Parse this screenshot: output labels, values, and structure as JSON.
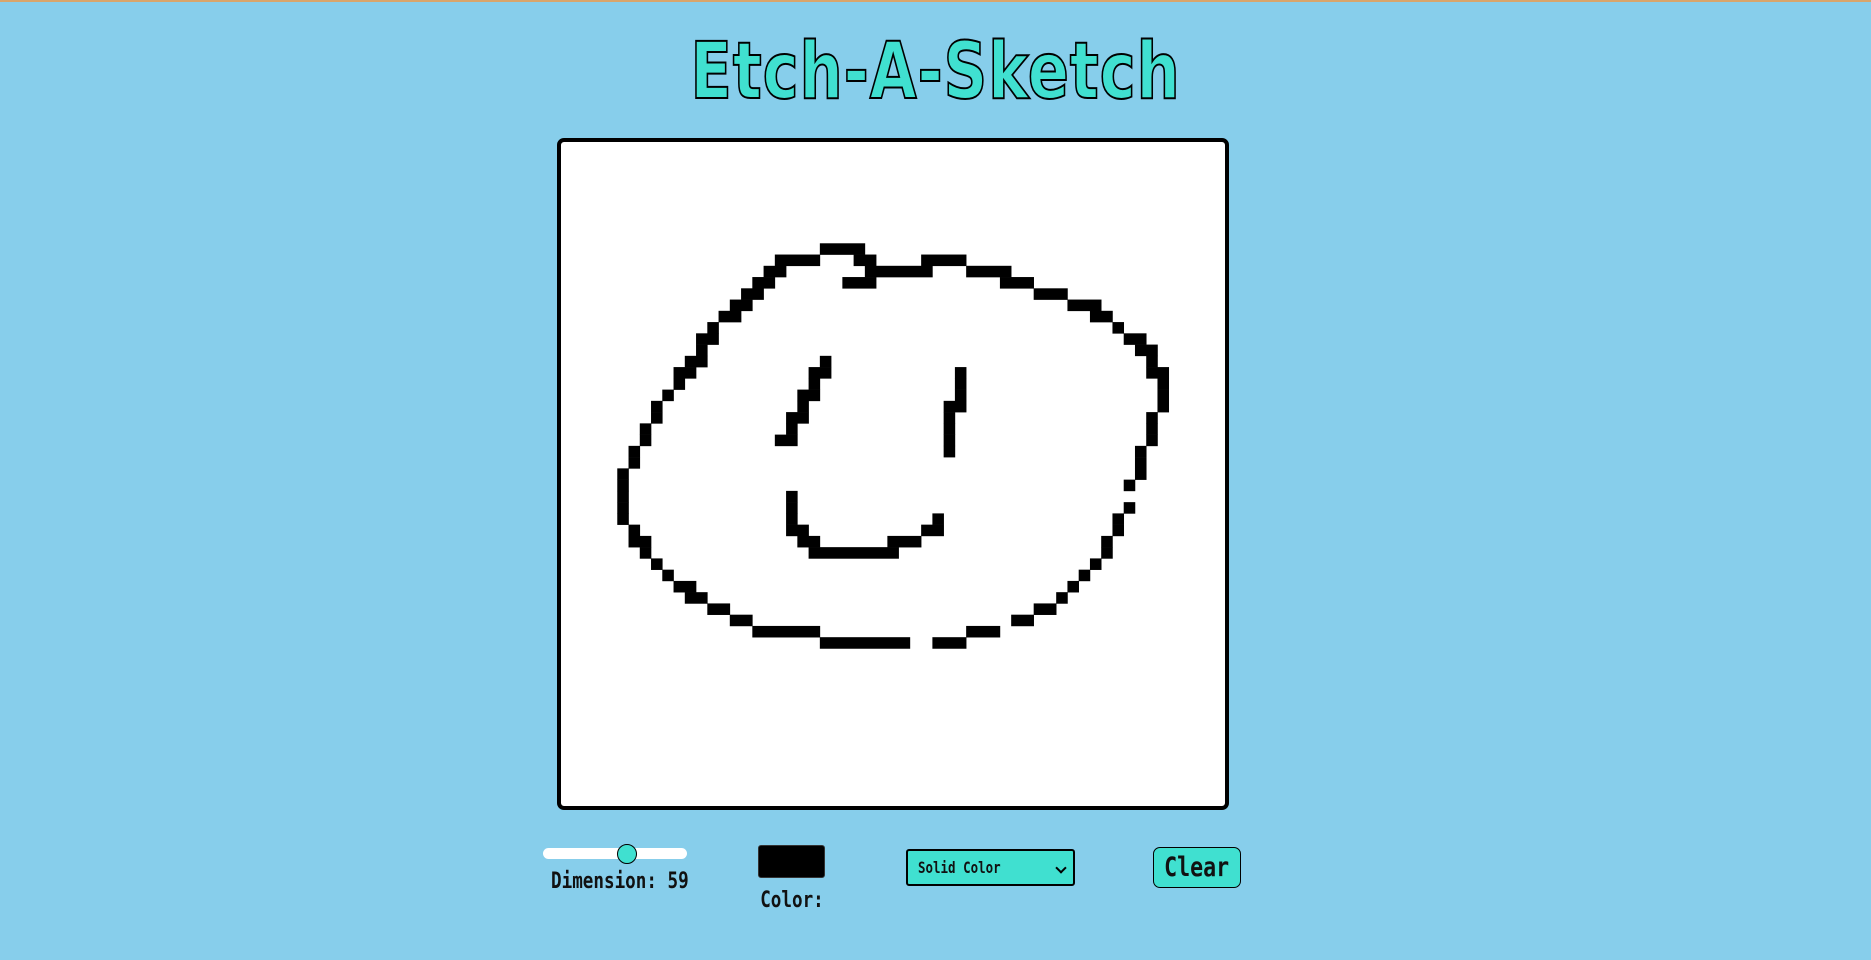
{
  "app": {
    "title": "Etch-A-Sketch"
  },
  "controls": {
    "dimension_label": "Dimension: 59",
    "dimension_value": 59,
    "dimension_min": 1,
    "dimension_max": 100,
    "color_label": "Color:",
    "color_value": "#000000",
    "mode_selected": "Solid Color",
    "clear_label": "Clear"
  },
  "colors": {
    "background": "#87ceeb",
    "accent": "#40e0d0",
    "board": "#ffffff",
    "ink": "#000000"
  },
  "sketch": {
    "grid_size": 59,
    "strokes": [
      [
        [
          23,
          9
        ],
        [
          26,
          9
        ]
      ],
      [
        [
          19,
          10
        ],
        [
          22,
          10
        ]
      ],
      [
        [
          26,
          10
        ],
        [
          27,
          10
        ]
      ],
      [
        [
          32,
          10
        ],
        [
          35,
          10
        ]
      ],
      [
        [
          18,
          11
        ],
        [
          19,
          11
        ]
      ],
      [
        [
          27,
          11
        ],
        [
          32,
          11
        ]
      ],
      [
        [
          36,
          11
        ],
        [
          39,
          11
        ]
      ],
      [
        [
          17,
          12
        ],
        [
          18,
          12
        ]
      ],
      [
        [
          25,
          12
        ],
        [
          27,
          12
        ]
      ],
      [
        [
          39,
          12
        ],
        [
          41,
          12
        ]
      ],
      [
        [
          16,
          13
        ],
        [
          17,
          13
        ]
      ],
      [
        [
          42,
          13
        ],
        [
          44,
          13
        ]
      ],
      [
        [
          15,
          14
        ],
        [
          16,
          14
        ]
      ],
      [
        [
          45,
          14
        ],
        [
          47,
          14
        ]
      ],
      [
        [
          14,
          15
        ],
        [
          15,
          15
        ]
      ],
      [
        [
          47,
          15
        ],
        [
          48,
          15
        ]
      ],
      [
        [
          13,
          16
        ],
        [
          13,
          16
        ]
      ],
      [
        [
          49,
          16
        ],
        [
          49,
          16
        ]
      ],
      [
        [
          12,
          17
        ],
        [
          13,
          17
        ]
      ],
      [
        [
          50,
          17
        ],
        [
          51,
          17
        ]
      ],
      [
        [
          12,
          18
        ],
        [
          12,
          18
        ]
      ],
      [
        [
          51,
          18
        ],
        [
          52,
          18
        ]
      ],
      [
        [
          11,
          19
        ],
        [
          12,
          19
        ]
      ],
      [
        [
          52,
          19
        ],
        [
          52,
          19
        ]
      ],
      [
        [
          10,
          20
        ],
        [
          11,
          20
        ]
      ],
      [
        [
          52,
          20
        ],
        [
          53,
          20
        ]
      ],
      [
        [
          10,
          21
        ],
        [
          10,
          21
        ]
      ],
      [
        [
          53,
          21
        ],
        [
          53,
          21
        ]
      ],
      [
        [
          9,
          22
        ],
        [
          9,
          22
        ]
      ],
      [
        [
          53,
          22
        ],
        [
          53,
          22
        ]
      ],
      [
        [
          8,
          23
        ],
        [
          8,
          23
        ]
      ],
      [
        [
          53,
          23
        ],
        [
          53,
          23
        ]
      ],
      [
        [
          8,
          24
        ],
        [
          8,
          24
        ]
      ],
      [
        [
          52,
          24
        ],
        [
          52,
          24
        ]
      ],
      [
        [
          7,
          25
        ],
        [
          7,
          25
        ]
      ],
      [
        [
          52,
          25
        ],
        [
          52,
          25
        ]
      ],
      [
        [
          7,
          26
        ],
        [
          7,
          26
        ]
      ],
      [
        [
          52,
          26
        ],
        [
          52,
          26
        ]
      ],
      [
        [
          6,
          27
        ],
        [
          6,
          27
        ]
      ],
      [
        [
          51,
          27
        ],
        [
          51,
          27
        ]
      ],
      [
        [
          6,
          28
        ],
        [
          6,
          28
        ]
      ],
      [
        [
          51,
          28
        ],
        [
          51,
          28
        ]
      ],
      [
        [
          5,
          29
        ],
        [
          5,
          29
        ]
      ],
      [
        [
          51,
          29
        ],
        [
          51,
          29
        ]
      ],
      [
        [
          5,
          30
        ],
        [
          5,
          30
        ]
      ],
      [
        [
          50,
          30
        ],
        [
          50,
          30
        ]
      ],
      [
        [
          5,
          31
        ],
        [
          5,
          31
        ]
      ],
      [
        [
          5,
          32
        ],
        [
          5,
          32
        ]
      ],
      [
        [
          50,
          32
        ],
        [
          50,
          32
        ]
      ],
      [
        [
          5,
          33
        ],
        [
          5,
          33
        ]
      ],
      [
        [
          49,
          33
        ],
        [
          49,
          33
        ]
      ],
      [
        [
          6,
          34
        ],
        [
          6,
          34
        ]
      ],
      [
        [
          49,
          34
        ],
        [
          49,
          34
        ]
      ],
      [
        [
          6,
          35
        ],
        [
          7,
          35
        ]
      ],
      [
        [
          48,
          35
        ],
        [
          48,
          35
        ]
      ],
      [
        [
          7,
          36
        ],
        [
          7,
          36
        ]
      ],
      [
        [
          48,
          36
        ],
        [
          48,
          36
        ]
      ],
      [
        [
          8,
          37
        ],
        [
          8,
          37
        ]
      ],
      [
        [
          47,
          37
        ],
        [
          47,
          37
        ]
      ],
      [
        [
          9,
          38
        ],
        [
          9,
          38
        ]
      ],
      [
        [
          46,
          38
        ],
        [
          46,
          38
        ]
      ],
      [
        [
          10,
          39
        ],
        [
          11,
          39
        ]
      ],
      [
        [
          45,
          39
        ],
        [
          45,
          39
        ]
      ],
      [
        [
          11,
          40
        ],
        [
          12,
          40
        ]
      ],
      [
        [
          44,
          40
        ],
        [
          44,
          40
        ]
      ],
      [
        [
          13,
          41
        ],
        [
          14,
          41
        ]
      ],
      [
        [
          42,
          41
        ],
        [
          43,
          41
        ]
      ],
      [
        [
          15,
          42
        ],
        [
          16,
          42
        ]
      ],
      [
        [
          40,
          42
        ],
        [
          41,
          42
        ]
      ],
      [
        [
          17,
          43
        ],
        [
          22,
          43
        ]
      ],
      [
        [
          36,
          43
        ],
        [
          38,
          43
        ]
      ],
      [
        [
          23,
          44
        ],
        [
          30,
          44
        ]
      ],
      [
        [
          33,
          44
        ],
        [
          35,
          44
        ]
      ],
      [
        [
          23,
          19
        ],
        [
          23,
          19
        ]
      ],
      [
        [
          22,
          20
        ],
        [
          23,
          20
        ]
      ],
      [
        [
          22,
          21
        ],
        [
          22,
          21
        ]
      ],
      [
        [
          21,
          22
        ],
        [
          22,
          22
        ]
      ],
      [
        [
          21,
          23
        ],
        [
          21,
          23
        ]
      ],
      [
        [
          20,
          24
        ],
        [
          21,
          24
        ]
      ],
      [
        [
          20,
          25
        ],
        [
          20,
          25
        ]
      ],
      [
        [
          19,
          26
        ],
        [
          20,
          26
        ]
      ],
      [
        [
          35,
          20
        ],
        [
          35,
          20
        ]
      ],
      [
        [
          35,
          21
        ],
        [
          35,
          21
        ]
      ],
      [
        [
          35,
          22
        ],
        [
          35,
          22
        ]
      ],
      [
        [
          34,
          23
        ],
        [
          35,
          23
        ]
      ],
      [
        [
          34,
          24
        ],
        [
          34,
          24
        ]
      ],
      [
        [
          34,
          25
        ],
        [
          34,
          25
        ]
      ],
      [
        [
          34,
          26
        ],
        [
          34,
          26
        ]
      ],
      [
        [
          34,
          27
        ],
        [
          34,
          27
        ]
      ],
      [
        [
          20,
          31
        ],
        [
          20,
          31
        ]
      ],
      [
        [
          20,
          32
        ],
        [
          20,
          32
        ]
      ],
      [
        [
          20,
          33
        ],
        [
          20,
          33
        ]
      ],
      [
        [
          20,
          34
        ],
        [
          21,
          34
        ]
      ],
      [
        [
          21,
          35
        ],
        [
          22,
          35
        ]
      ],
      [
        [
          22,
          36
        ],
        [
          29,
          36
        ]
      ],
      [
        [
          29,
          35
        ],
        [
          31,
          35
        ]
      ],
      [
        [
          32,
          34
        ],
        [
          33,
          34
        ]
      ],
      [
        [
          33,
          33
        ],
        [
          33,
          33
        ]
      ]
    ]
  }
}
